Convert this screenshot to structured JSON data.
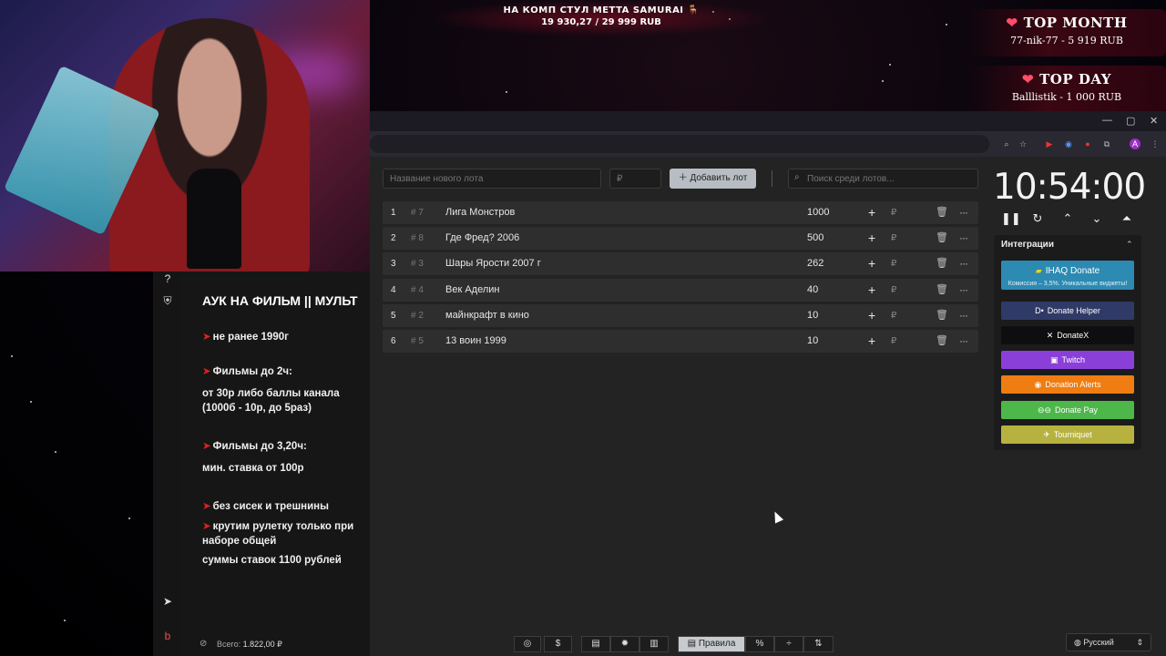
{
  "goal": {
    "title": "НА КОМП СТУЛ METTA SAMURAI 🪑",
    "value": "19 930,27 / 29 999 RUB"
  },
  "top_month": {
    "title": "TOP MONTH",
    "entry": "77-nik-77 - 5 919 RUB"
  },
  "top_day": {
    "title": "TOP DAY",
    "entry": "Balllistik - 1 000 RUB"
  },
  "rules": {
    "title": "АУК НА ФИЛЬМ || МУЛЬТ",
    "l1": "не ранее 1990г",
    "l2": "Фильмы до 2ч:",
    "l3": "от 30р либо баллы канала",
    "l4": "(1000б - 10р, до 5раз)",
    "l5": "Фильмы до 3,20ч:",
    "l6": "мин. ставка от 100р",
    "l7": "без сисек и трешнины",
    "l8": "крутим рулетку только при",
    "l9": "наборе общей",
    "l10": "суммы ставок 1100 рублей"
  },
  "toolbar": {
    "new_lot_placeholder": "Название нового лота",
    "amount_placeholder": "₽",
    "add_label": "Добавить лот",
    "search_placeholder": "Поиск среди лотов..."
  },
  "lots": [
    {
      "num": "1",
      "id": "# 7",
      "name": "Лига Монстров",
      "amount": "1000"
    },
    {
      "num": "2",
      "id": "# 8",
      "name": "Где Фред? 2006",
      "amount": "500"
    },
    {
      "num": "3",
      "id": "# 3",
      "name": "Шары Ярости 2007 г",
      "amount": "262"
    },
    {
      "num": "4",
      "id": "# 4",
      "name": "Век Аделин",
      "amount": "40"
    },
    {
      "num": "5",
      "id": "# 2",
      "name": "майнкрафт в кино",
      "amount": "10"
    },
    {
      "num": "6",
      "id": "# 5",
      "name": "13 воин 1999",
      "amount": "10"
    }
  ],
  "lot_row": {
    "plus": "+",
    "currency": "₽",
    "delete": "🗑",
    "more": "···"
  },
  "timer": "10:54:00",
  "integrations": {
    "title": "Интеграции",
    "ihaq": {
      "label": "IHAQ Donate",
      "sub": "Комиссия – 3,5%. Уникальные виджеты!"
    },
    "items": [
      {
        "label": "Donate Helper",
        "color": "#2f3a66"
      },
      {
        "label": "DonateX",
        "color": "#0e0e10"
      },
      {
        "label": "Twitch",
        "color": "#8b3fd9"
      },
      {
        "label": "Donation Alerts",
        "color": "#ef7d12"
      },
      {
        "label": "Donate Pay",
        "color": "#4db74a"
      },
      {
        "label": "Tourniquet",
        "color": "#b7b23f"
      }
    ]
  },
  "bottom": {
    "total_label": "Всего:",
    "total_value": "1.822,00 ₽",
    "rules_label": "Правила",
    "language": "Русский"
  }
}
